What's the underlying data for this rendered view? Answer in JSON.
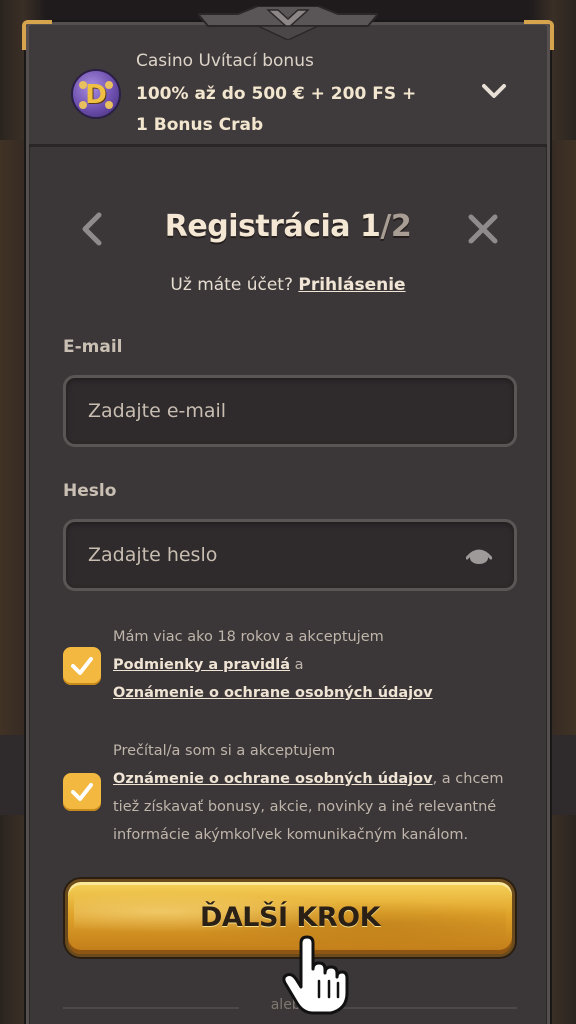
{
  "bonus": {
    "title": "Casino Uvítací bonus",
    "offer": "100% až do 500 € + 200 FS + 1 Bonus Crab",
    "coin_letter": "D"
  },
  "header": {
    "title": "Registrácia 1",
    "step_total": "/2"
  },
  "login_prompt": {
    "text": "Už máte účet?",
    "link": "Prihlásenie"
  },
  "email": {
    "label": "E-mail",
    "placeholder": "Zadajte e-mail",
    "value": ""
  },
  "password": {
    "label": "Heslo",
    "placeholder": "Zadajte heslo",
    "value": ""
  },
  "consent_age": {
    "checked": true,
    "text_before": "Mám viac ako 18 rokov a akceptujem",
    "link1": "Podmienky a pravidlá",
    "joiner": " a",
    "link2": "Oznámenie o ochrane osobných údajov"
  },
  "consent_marketing": {
    "checked": true,
    "text_before": "Prečítal/a som si a akceptujem",
    "link": "Oznámenie o ochrane osobných údajov",
    "text_after": ", a chcem tiež získavať bonusy, akcie, novinky a iné relevantné informácie akýmkoľvek komunikačným kanálom."
  },
  "next_button": {
    "label": "ĎALŠÍ KROK"
  },
  "divider": {
    "text": "alebo"
  },
  "colors": {
    "accent_gold": "#f2b840",
    "panel": "#3b3638",
    "field_bg": "#2f2b2d"
  }
}
